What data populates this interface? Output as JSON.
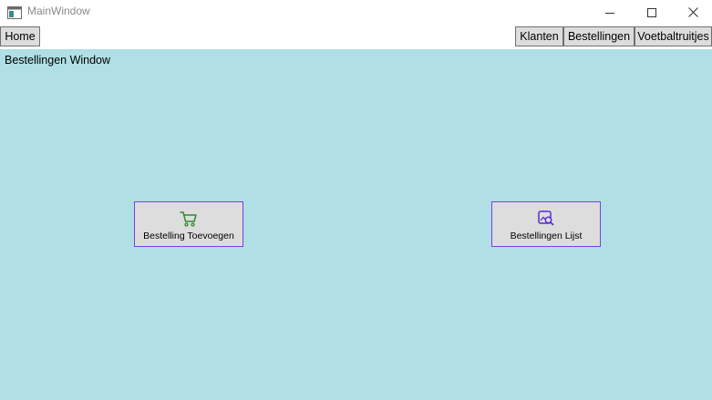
{
  "window": {
    "title": "MainWindow"
  },
  "menu": {
    "home": "Home",
    "klanten": "Klanten",
    "bestellingen": "Bestellingen",
    "voetbaltruitjes": "Voetbaltruitjes"
  },
  "content": {
    "label": "Bestellingen Window",
    "background": "#b0dfe5",
    "actions": [
      {
        "label": "Bestelling Toevoegen",
        "icon": "cart-icon",
        "icon_color": "#2e8b2e"
      },
      {
        "label": "Bestellingen Lijst",
        "icon": "image-search-icon",
        "icon_color": "#5a2bd6"
      }
    ]
  }
}
